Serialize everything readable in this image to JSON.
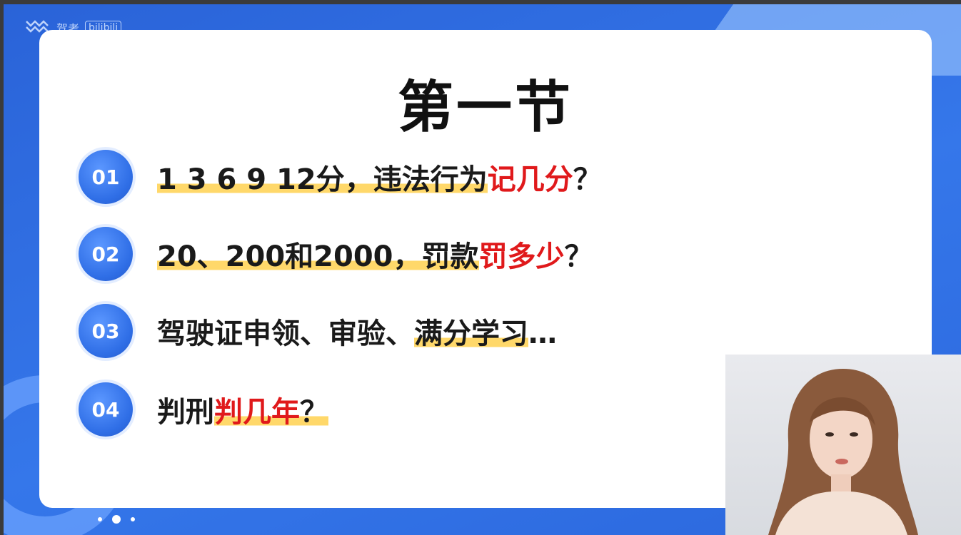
{
  "logo": {
    "text": "驾考",
    "tag": "bilibili"
  },
  "slide": {
    "title": "第一节",
    "items": [
      {
        "num": "01",
        "plain": "1 3 6 9 12分，违法行为",
        "red": "记几分",
        "tail": "？"
      },
      {
        "num": "02",
        "plain": "20、200和2000，罚款",
        "red": "罚多少",
        "tail": "？"
      },
      {
        "num": "03",
        "plain": "驾驶证申领、审验、",
        "highlight": "满分学习",
        "tail": "…"
      },
      {
        "num": "04",
        "plain": "判刑",
        "red": "判几年",
        "tail": "？"
      }
    ]
  },
  "pagination": {
    "count": 3,
    "active_index": 1
  },
  "colors": {
    "accent": "#2f6ee6",
    "highlight": "#ffd86a",
    "emphasis": "#e0191b"
  }
}
